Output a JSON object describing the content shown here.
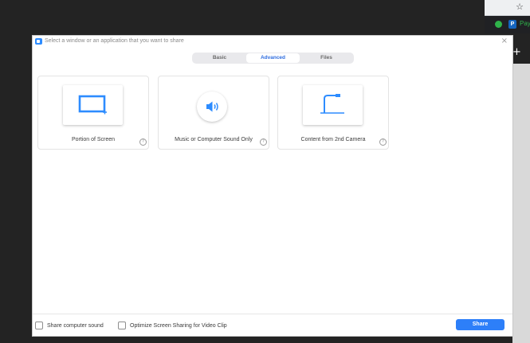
{
  "dialog": {
    "title": "Select a window or an application that you want to share",
    "close_glyph": "×"
  },
  "tabs": [
    {
      "label": "Basic",
      "active": false
    },
    {
      "label": "Advanced",
      "active": true
    },
    {
      "label": "Files",
      "active": false
    }
  ],
  "cards": [
    {
      "label": "Portion of Screen",
      "icon": "screen-portion-icon"
    },
    {
      "label": "Music or Computer Sound Only",
      "icon": "speaker-icon"
    },
    {
      "label": "Content from 2nd Camera",
      "icon": "document-camera-icon"
    }
  ],
  "help_glyph": "?",
  "footer": {
    "share_sound_label": "Share computer sound",
    "optimize_label": "Optimize Screen Sharing for Video Clip",
    "share_button": "Share"
  },
  "background": {
    "star_glyph": "☆",
    "ext_label": "Pay",
    "ext_p": "P",
    "new_tab_glyph": "+"
  },
  "colors": {
    "accent": "#2d8cff",
    "active_tab_text": "#2d6cdf",
    "share_button": "#2d7ff9"
  }
}
